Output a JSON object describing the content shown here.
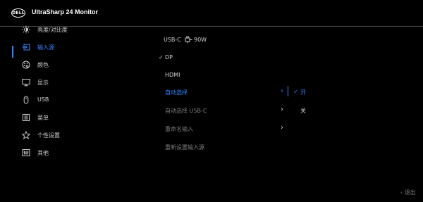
{
  "header": {
    "logo_text": "DELL",
    "title": "UltraSharp 24 Monitor"
  },
  "main_menu": [
    {
      "label": "亮度/对比度",
      "icon": "brightness-icon",
      "active": false
    },
    {
      "label": "输入源",
      "icon": "input-source-icon",
      "active": true
    },
    {
      "label": "颜色",
      "icon": "color-palette-icon",
      "active": false
    },
    {
      "label": "显示",
      "icon": "display-icon",
      "active": false
    },
    {
      "label": "USB",
      "icon": "usb-mouse-icon",
      "active": false
    },
    {
      "label": "菜单",
      "icon": "menu-icon",
      "active": false
    },
    {
      "label": "个性设置",
      "icon": "star-icon",
      "active": false
    },
    {
      "label": "其他",
      "icon": "other-icon",
      "active": false
    }
  ],
  "submenu": {
    "usbc": {
      "label": "USB-C",
      "power": "90W"
    },
    "dp": {
      "label": "DP",
      "check": "✓"
    },
    "hdmi": {
      "label": "HDMI"
    },
    "auto_select": {
      "label": "自动选择",
      "arrow": "›"
    },
    "auto_select_usbc": {
      "label": "自动选择 USB-C",
      "arrow": "›"
    },
    "rename_input": {
      "label": "重命名输入",
      "arrow": "›"
    },
    "reset_input": {
      "label": "重新设置输入源"
    }
  },
  "options": {
    "on": {
      "label": "开",
      "check": "✓"
    },
    "off": {
      "label": "关"
    }
  },
  "footer": {
    "exit_label": "‹ 退出"
  },
  "colors": {
    "accent": "#2f86ff",
    "background": "#000000"
  }
}
